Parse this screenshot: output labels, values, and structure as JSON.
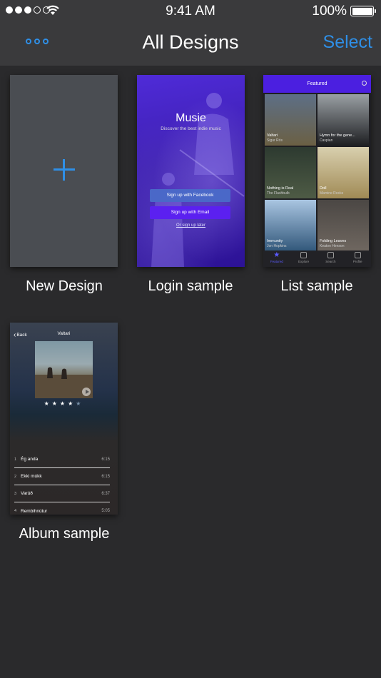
{
  "status_bar": {
    "time": "9:41 AM",
    "battery_pct": "100%",
    "signal_bars_filled": 3,
    "signal_bars_total": 5
  },
  "nav": {
    "title": "All Designs",
    "select_label": "Select",
    "more_icon": "ellipsis-icon"
  },
  "colors": {
    "accent": "#2f8fe6",
    "background": "#2a2a2c",
    "bar": "#3a3a3c"
  },
  "designs": [
    {
      "label": "New Design",
      "icon": "plus-icon"
    },
    {
      "label": "Login sample",
      "preview": {
        "app_name": "Musie",
        "tagline": "Discover the best indie music",
        "facebook_button": "Sign up with Facebook",
        "email_button": "Sign up with Email",
        "later_link": "Or sign up later"
      }
    },
    {
      "label": "List sample",
      "preview": {
        "header": "Featured",
        "tiles": [
          {
            "title": "Valtari",
            "subtitle": "Sigur Rós",
            "color_top": "#5d6f86",
            "color_bottom": "#6b6044"
          },
          {
            "title": "Hymn for the gene...",
            "subtitle": "Caspian",
            "color_top": "#9aa0a4",
            "color_bottom": "#1e1f22"
          },
          {
            "title": "Nothing is Real",
            "subtitle": "The Flashbulb",
            "color_top": "#2d3a30",
            "color_bottom": "#4e5b45"
          },
          {
            "title": "Doll",
            "subtitle": "Mamine Rocks",
            "color_top": "#d8cfae",
            "color_bottom": "#a08a55"
          },
          {
            "title": "Immunity",
            "subtitle": "Jon Hopkins",
            "color_top": "#a9c5e1",
            "color_bottom": "#31577a"
          },
          {
            "title": "Folding Leaves",
            "subtitle": "Keaton Henson",
            "color_top": "#4b4744",
            "color_bottom": "#6f6760"
          }
        ],
        "tabs": [
          {
            "label": "Featured",
            "icon": "star-icon",
            "active": true
          },
          {
            "label": "Explore",
            "icon": "explore-icon",
            "active": false
          },
          {
            "label": "Search",
            "icon": "search-icon",
            "active": false
          },
          {
            "label": "Profile",
            "icon": "profile-icon",
            "active": false
          }
        ]
      }
    },
    {
      "label": "Album sample",
      "preview": {
        "back_label": "Back",
        "title": "Valtari",
        "rating": 4,
        "rating_max": 5,
        "tracks": [
          {
            "no": "1",
            "name": "Ég anda",
            "duration": "6:15"
          },
          {
            "no": "2",
            "name": "Ekki múkk",
            "duration": "6:15"
          },
          {
            "no": "3",
            "name": "Varúð",
            "duration": "6:37"
          },
          {
            "no": "4",
            "name": "Rembihnútur",
            "duration": "5:05"
          }
        ]
      }
    }
  ]
}
